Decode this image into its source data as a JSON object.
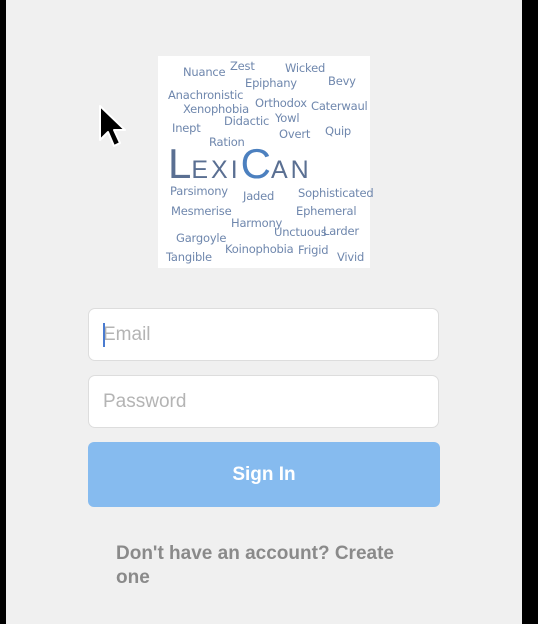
{
  "logo": {
    "brand_prefix_L": "L",
    "brand_mid": "EXI",
    "brand_C": "C",
    "brand_suffix": "AN",
    "cloud_words": [
      "Nuance",
      "Zest",
      "Wicked",
      "Epiphany",
      "Bevy",
      "Anachronistic",
      "Orthodox",
      "Xenophobia",
      "Caterwaul",
      "Didactic",
      "Yowl",
      "Inept",
      "Overt",
      "Quip",
      "Ration",
      "Parsimony",
      "Jaded",
      "Sophisticated",
      "Mesmerise",
      "Ephemeral",
      "Harmony",
      "Unctuous",
      "Larder",
      "Gargoyle",
      "Koinophobia",
      "Frigid",
      "Tangible",
      "Vivid"
    ]
  },
  "form": {
    "email_placeholder": "Email",
    "password_placeholder": "Password",
    "signin_label": "Sign In",
    "create_account_text": "Don't have an account? Create one"
  },
  "colors": {
    "background": "#f0f0f0",
    "button": "#86bbef",
    "cloud_text": "#6f87ad",
    "brand": "#5a6f92"
  },
  "icons": {
    "pointer": "mouse-pointer-icon"
  }
}
